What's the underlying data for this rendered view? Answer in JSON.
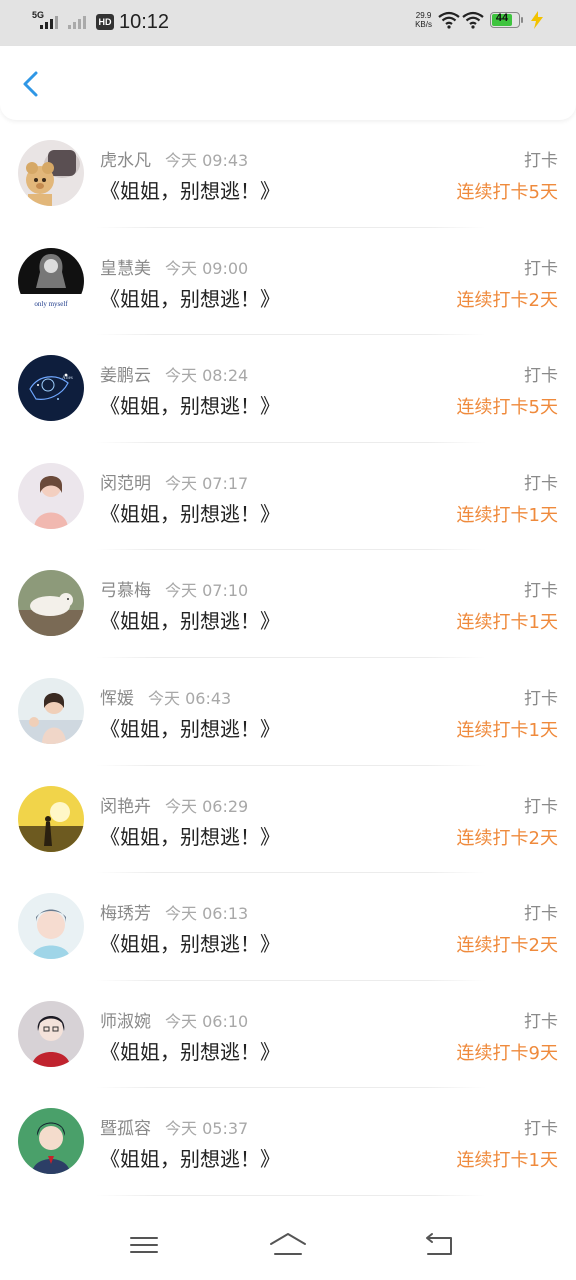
{
  "status_bar": {
    "network": "5G",
    "hd_label": "HD",
    "time": "10:12",
    "speed_value": "29.9",
    "speed_unit": "KB/s",
    "battery": "44",
    "icons": [
      "signal-icon",
      "signal-secondary-icon",
      "hd-icon",
      "wifi-icon",
      "wifi-icon",
      "battery-icon",
      "charging-icon"
    ]
  },
  "header": {
    "back_icon": "chevron-left-icon"
  },
  "colors": {
    "accent": "#ef8a3c",
    "back": "#2f97e6",
    "muted": "#8a8a8a"
  },
  "items": [
    {
      "name": "虎水凡",
      "time": "今天 09:43",
      "title": "《姐姐，别想逃！》",
      "action": "打卡",
      "streak": "连续打卡5天"
    },
    {
      "name": "皇慧美",
      "time": "今天 09:00",
      "title": "《姐姐，别想逃！》",
      "action": "打卡",
      "streak": "连续打卡2天",
      "avatar_text": "only myself"
    },
    {
      "name": "姜鹏云",
      "time": "今天 08:24",
      "title": "《姐姐，别想逃！》",
      "action": "打卡",
      "streak": "连续打卡5天"
    },
    {
      "name": "闵范明",
      "time": "今天 07:17",
      "title": "《姐姐，别想逃！》",
      "action": "打卡",
      "streak": "连续打卡1天"
    },
    {
      "name": "弓慕梅",
      "time": "今天 07:10",
      "title": "《姐姐，别想逃！》",
      "action": "打卡",
      "streak": "连续打卡1天"
    },
    {
      "name": "恽媛",
      "time": "今天 06:43",
      "title": "《姐姐，别想逃！》",
      "action": "打卡",
      "streak": "连续打卡1天"
    },
    {
      "name": "闵艳卉",
      "time": "今天 06:29",
      "title": "《姐姐，别想逃！》",
      "action": "打卡",
      "streak": "连续打卡2天"
    },
    {
      "name": "梅琇芳",
      "time": "今天 06:13",
      "title": "《姐姐，别想逃！》",
      "action": "打卡",
      "streak": "连续打卡2天"
    },
    {
      "name": "师淑婉",
      "time": "今天 06:10",
      "title": "《姐姐，别想逃！》",
      "action": "打卡",
      "streak": "连续打卡9天"
    },
    {
      "name": "暨孤容",
      "time": "今天 05:37",
      "title": "《姐姐，别想逃！》",
      "action": "打卡",
      "streak": "连续打卡1天"
    }
  ],
  "navbar": {
    "icons": [
      "menu-icon",
      "home-icon",
      "back-icon"
    ]
  }
}
